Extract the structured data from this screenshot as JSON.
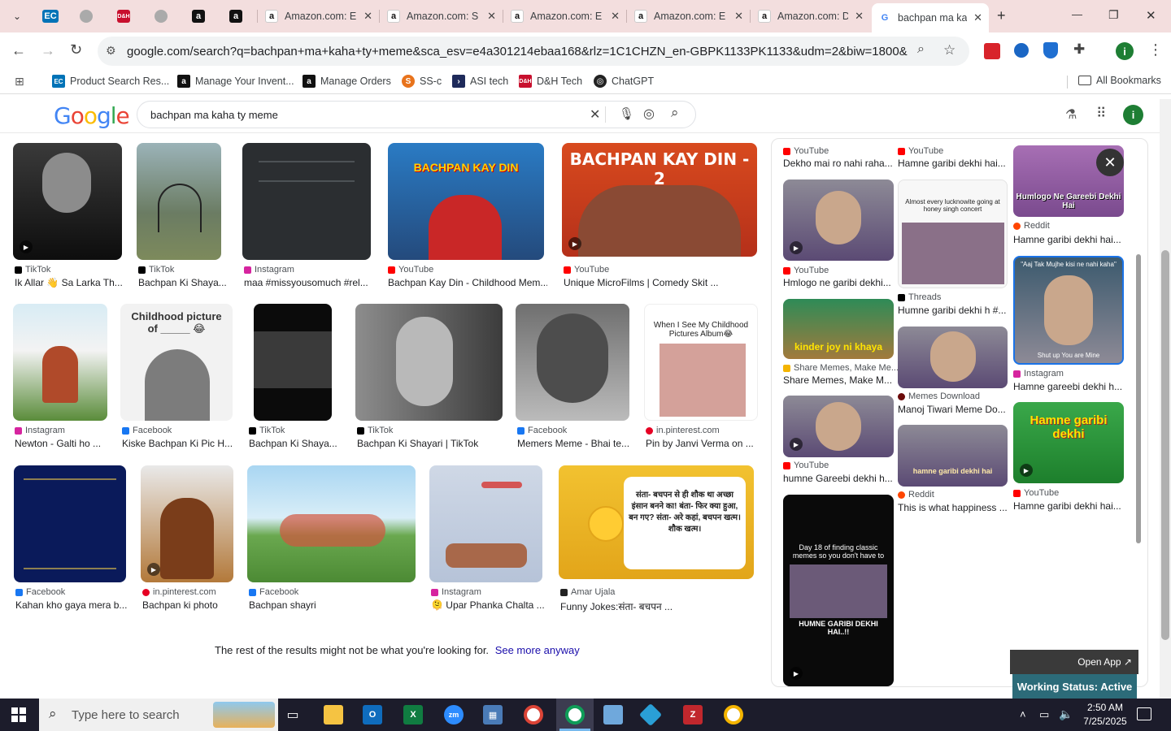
{
  "tabs": [
    {
      "label": "",
      "fav": "chevron-down"
    },
    {
      "label": "",
      "fav": "EC"
    },
    {
      "label": "",
      "fav": "globe"
    },
    {
      "label": "",
      "fav": "D&H"
    },
    {
      "label": "",
      "fav": "globe"
    },
    {
      "label": "",
      "fav": "a"
    },
    {
      "label": "",
      "fav": "a"
    },
    {
      "label": "Amazon.com: E",
      "fav": "a"
    },
    {
      "label": "Amazon.com: S",
      "fav": "a"
    },
    {
      "label": "Amazon.com: E",
      "fav": "a"
    },
    {
      "label": "Amazon.com: E",
      "fav": "a"
    },
    {
      "label": "Amazon.com: D",
      "fav": "a"
    },
    {
      "label": "bachpan ma ka",
      "fav": "G"
    }
  ],
  "window": {
    "minimize": "—",
    "maximize": "❐",
    "close": "✕",
    "new_tab": "+"
  },
  "toolbar": {
    "url": "google.com/search?q=bachpan+ma+kaha+ty+meme&sca_esv=e4a301214ebaa168&rlz=1C1CHZN_en-GBPK1133PK1133&udm=2&biw=1800&bih=923...",
    "profile": "i"
  },
  "bookmarks": [
    {
      "label": "Product Search Res...",
      "color": "#0073b7",
      "icon": "EC"
    },
    {
      "label": "Manage Your Invent...",
      "color": "#111111",
      "icon": "a"
    },
    {
      "label": "Manage Orders",
      "color": "#111111",
      "icon": "a"
    },
    {
      "label": "SS-c",
      "color": "#e8731c",
      "icon": "S"
    },
    {
      "label": "ASI tech",
      "color": "#1e2a5a",
      "icon": ">"
    },
    {
      "label": "D&H Tech",
      "color": "#c8102e",
      "icon": "D"
    },
    {
      "label": "ChatGPT",
      "color": "#222222",
      "icon": "◎"
    }
  ],
  "all_bookmarks": "All Bookmarks",
  "google": {
    "logo": [
      "G",
      "o",
      "o",
      "g",
      "l",
      "e"
    ],
    "logo_colors": [
      "#4285f4",
      "#ea4335",
      "#fbbc05",
      "#4285f4",
      "#34a853",
      "#ea4335"
    ],
    "query": "bachpan ma kaha ty meme",
    "profile": "i"
  },
  "results": [
    {
      "source": "TikTok",
      "title": "Ik Allar 👋 Sa Larka Th...",
      "srcColor": "#000"
    },
    {
      "source": "TikTok",
      "title": "Bachpan Ki Shaya...",
      "srcColor": "#000"
    },
    {
      "source": "Instagram",
      "title": "maa #missyousomuch #rel...",
      "srcColor": "#d6249f"
    },
    {
      "source": "YouTube",
      "title": "Bachpan Kay Din - Childhood Mem...",
      "srcColor": "#ff0000",
      "overlay": "BACHPAN KAY DIN"
    },
    {
      "source": "YouTube",
      "title": "Unique MicroFilms | Comedy Skit ...",
      "srcColor": "#ff0000",
      "overlay": "BACHPAN KAY DIN - 2"
    },
    {
      "source": "Instagram",
      "title": "Newton - Galti ho ...",
      "srcColor": "#d6249f"
    },
    {
      "source": "Facebook",
      "title": "Kiske Bachpan Ki Pic H...",
      "srcColor": "#1877f2",
      "overlay": "Childhood picture of _____ 😂"
    },
    {
      "source": "TikTok",
      "title": "Bachpan Ki Shaya...",
      "srcColor": "#000"
    },
    {
      "source": "TikTok",
      "title": "Bachpan Ki Shayari | TikTok",
      "srcColor": "#000"
    },
    {
      "source": "Facebook",
      "title": "Memers Meme - Bhai te...",
      "srcColor": "#1877f2"
    },
    {
      "source": "in.pinterest.com",
      "title": "Pin by Janvi Verma on ...",
      "srcColor": "#e60023",
      "overlay": "When I See My Childhood Pictures Album😂"
    },
    {
      "source": "Facebook",
      "title": "Kahan kho gaya mera b...",
      "srcColor": "#1877f2"
    },
    {
      "source": "in.pinterest.com",
      "title": "Bachpan ki photo",
      "srcColor": "#e60023"
    },
    {
      "source": "Facebook",
      "title": "Bachpan shayri",
      "srcColor": "#1877f2"
    },
    {
      "source": "Instagram",
      "title": "🫠 Upar Phanka Chalta ...",
      "srcColor": "#d6249f"
    },
    {
      "source": "Amar Ujala",
      "title": "Funny Jokes:संता- बचपन ...",
      "srcColor": "#222",
      "overlay": "संता- बचपन से ही शौक था अच्छा इंसान बनने का! बंता- फिर क्या हुआ, बन गए? संता- अरे कहां, बचपन खत्म। शौक खत्म।"
    }
  ],
  "rest_note": "The rest of the results might not be what you're looking for.",
  "see_more": "See more anyway",
  "panel": {
    "items": [
      {
        "source": "YouTube",
        "title": "Dekho mai ro nahi raha...",
        "srcColor": "#ff0000"
      },
      {
        "source": "YouTube",
        "title": "Hamne garibi dekhi hai...",
        "srcColor": "#ff0000"
      },
      {
        "source": "Reddit",
        "title": "Hamne garibi dekhi hai...",
        "srcColor": "#ff4500",
        "overlay": "Humlogo Ne Gareebi Dekhi Hai"
      },
      {
        "source": "YouTube",
        "title": "Hmlogo ne garibi dekhi...",
        "srcColor": "#ff0000"
      },
      {
        "source": "Threads",
        "title": "Humne garibi dekhi h #...",
        "srcColor": "#000",
        "overlay": "Almost every lucknowite going at honey singh concert"
      },
      {
        "source": "Instagram",
        "title": "Hamne gareebi dekhi h...",
        "srcColor": "#d6249f",
        "overlay": "Shut up You are Mine"
      },
      {
        "source": "Share Memes, Make Me...",
        "title": "Share Memes, Make M...",
        "srcColor": "#f4b400",
        "overlay": "kinder joy ni khaya"
      },
      {
        "source": "Memes Download",
        "title": "Manoj Tiwari Meme Do...",
        "srcColor": "#6b0a0a"
      },
      {
        "source": "YouTube",
        "title": "Hamne garibi dekhi hai...",
        "srcColor": "#ff0000",
        "overlay": "Hamne garibi dekhi"
      },
      {
        "source": "YouTube",
        "title": "humne Gareebi dekhi h...",
        "srcColor": "#ff0000"
      },
      {
        "source": "Reddit",
        "title": "This is what happiness ...",
        "srcColor": "#ff4500",
        "overlay": "hamne garibi dekhi hai"
      },
      {
        "source": "",
        "title": "",
        "srcColor": "#000",
        "overlay": "Day 18 of finding classic memes so you don't have to",
        "overlay2": "HUMNE GARIBI DEKHI HAI..!!"
      }
    ],
    "close": "✕"
  },
  "overlay_app": {
    "open_app": "Open App ↗",
    "status": "Working Status: Active"
  },
  "taskbar": {
    "search": "Type here to search",
    "time": "2:50 AM",
    "date": "7/25/2025"
  }
}
